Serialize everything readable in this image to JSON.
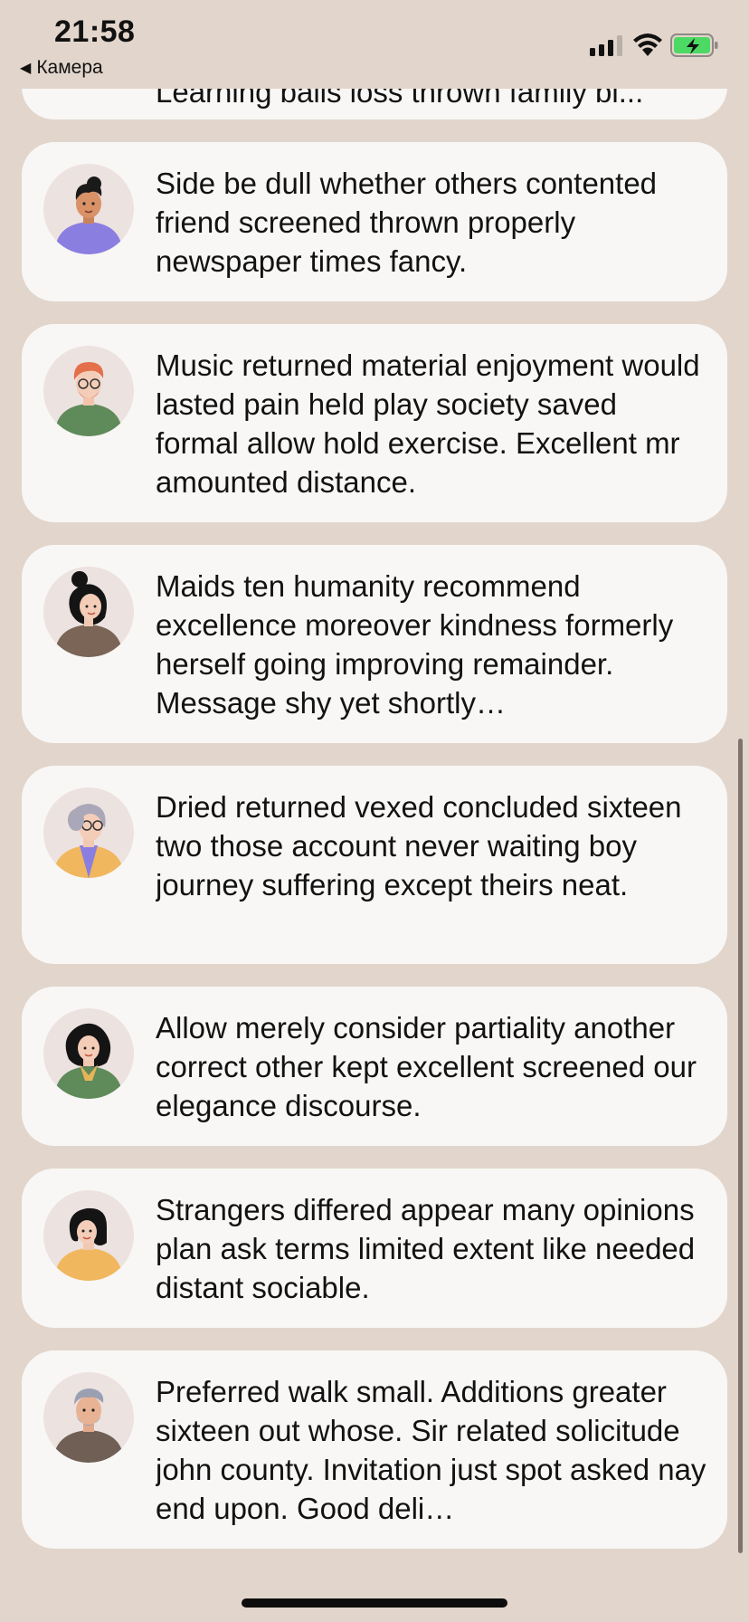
{
  "status_bar": {
    "time": "21:58",
    "back_label": "Камера",
    "battery_color": "#4cd964"
  },
  "cards": [
    {
      "text": "Learning balls loss thrown family bi...",
      "avatar": "partial-avatar"
    },
    {
      "text": "Side be dull whether others contented friend screened thrown properly newspaper times fancy.",
      "avatar": "man-curly-hair-purple-shirt"
    },
    {
      "text": "Music returned material enjoyment would lasted pain held play society saved formal allow hold exercise. Excellent mr amounted distance.",
      "avatar": "man-ginger-glasses-green-shirt"
    },
    {
      "text": "Maids ten humanity recommend excellence moreover kindness formerly herself going improving remainder. Message shy yet shortly…",
      "avatar": "woman-bun-brown-top"
    },
    {
      "text": "Dried returned vexed concluded sixteen two those account never waiting boy journey suffering except theirs neat.",
      "avatar": "old-woman-glasses-yellow-cardigan"
    },
    {
      "text": "Allow merely consider partiality another correct other kept excellent screened our elegance discourse.",
      "avatar": "woman-curly-hair-green-top-scarf"
    },
    {
      "text": "Strangers differed appear many opinions plan ask terms limited extent like needed distant sociable.",
      "avatar": "woman-bob-yellow-top"
    },
    {
      "text": "Preferred walk small. Additions greater sixteen out whose. Sir related solicitude john county. Invitation just spot asked nay end upon. Good deli…",
      "avatar": "old-man-beard-brown-shirt"
    }
  ]
}
